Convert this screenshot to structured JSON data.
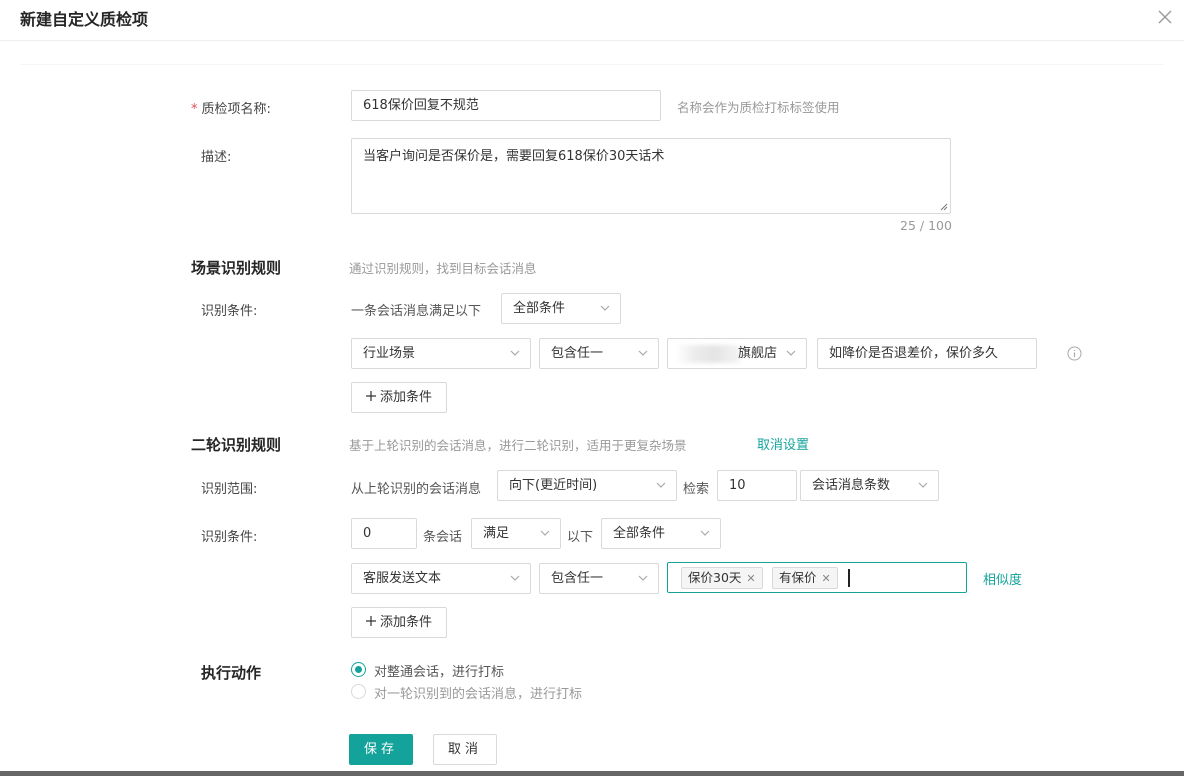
{
  "dialog": {
    "title": "新建自定义质检项"
  },
  "name_field": {
    "required_mark": "*",
    "label": "质检项名称:",
    "value": "618保价回复不规范",
    "hint": "名称会作为质检打标标签使用"
  },
  "description": {
    "label": "描述:",
    "value": "当客户询问是否保价是，需要回复618保价30天话术",
    "counter": "25 / 100"
  },
  "scene_rules": {
    "title": "场景识别规则",
    "desc": "通过识别规则，找到目标会话消息",
    "condition_label": "识别条件:",
    "condition_prefix": "一条会话消息满足以下",
    "match_mode": "全部条件",
    "row": {
      "field": "行业场景",
      "operator": "包含任一",
      "scene": "旗舰店",
      "value": "如降价是否退差价，保价多久"
    },
    "add_condition": "添加条件"
  },
  "second_rules": {
    "title": "二轮识别规则",
    "desc": "基于上轮识别的会话消息，进行二轮识别，适用于更复杂场景",
    "cancel_link": "取消设置",
    "scope_label": "识别范围:",
    "scope_prefix": "从上轮识别的会话消息",
    "direction": "向下(更近时间)",
    "search_text": "检索",
    "search_count": "10",
    "unit": "会话消息条数",
    "condition_label": "识别条件:",
    "session_count": "0",
    "session_text": "条会话",
    "satisfy": "满足",
    "below_text": "以下",
    "match_mode": "全部条件",
    "row": {
      "field": "客服发送文本",
      "operator": "包含任一",
      "tags": [
        "保价30天",
        "有保价"
      ],
      "similarity": "相似度"
    },
    "add_condition": "添加条件"
  },
  "actions": {
    "title": "执行动作",
    "options": [
      "对整通会话，进行打标",
      "对一轮识别到的会话消息，进行打标"
    ],
    "selected_index": 0
  },
  "footer": {
    "save": "保存",
    "cancel": "取消"
  },
  "colors": {
    "accent": "#14a39b",
    "required": "#e34d59",
    "hint": "#999999",
    "border": "#d9d9d9"
  },
  "icons": [
    "close-icon",
    "chevron-down-icon",
    "plus-icon",
    "info-icon",
    "tag-close-icon"
  ]
}
